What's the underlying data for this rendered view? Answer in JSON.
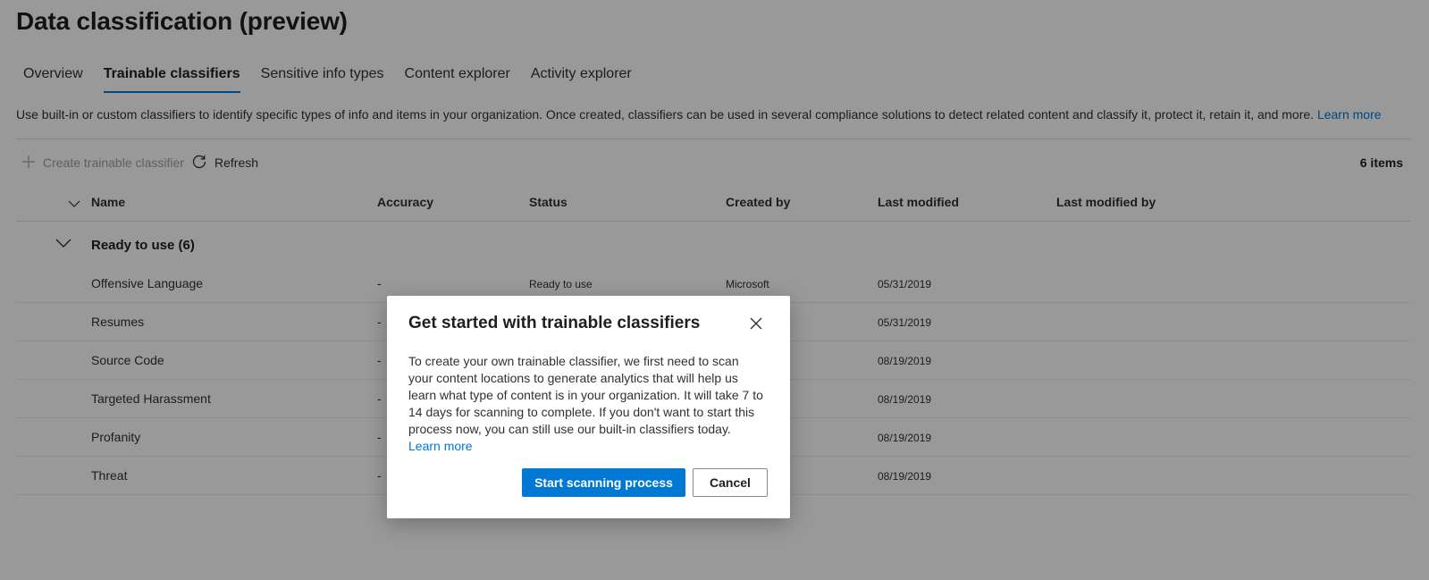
{
  "page": {
    "title": "Data classification (preview)"
  },
  "tabs": [
    {
      "label": "Overview"
    },
    {
      "label": "Trainable classifiers"
    },
    {
      "label": "Sensitive info types"
    },
    {
      "label": "Content explorer"
    },
    {
      "label": "Activity explorer"
    }
  ],
  "active_tab": "Trainable classifiers",
  "description": {
    "text": "Use built-in or custom classifiers to identify specific types of info and items in your organization. Once created, classifiers can be used in several compliance solutions to detect related content and classify it, protect it, retain it, and more.",
    "link": "Learn more"
  },
  "toolbar": {
    "create_label": "Create trainable classifier",
    "refresh_label": "Refresh",
    "items_count": "6 items"
  },
  "columns": {
    "name": "Name",
    "accuracy": "Accuracy",
    "status": "Status",
    "created_by": "Created by",
    "last_modified": "Last modified",
    "last_modified_by": "Last modified by"
  },
  "group": {
    "title": "Ready to use (6)"
  },
  "rows": [
    {
      "name": "Offensive Language",
      "accuracy": "-",
      "status": "Ready to use",
      "created_by": "Microsoft",
      "last_modified": "05/31/2019",
      "last_modified_by": ""
    },
    {
      "name": "Resumes",
      "accuracy": "-",
      "status": "",
      "created_by": "",
      "last_modified": "05/31/2019",
      "last_modified_by": ""
    },
    {
      "name": "Source Code",
      "accuracy": "-",
      "status": "",
      "created_by": "",
      "last_modified": "08/19/2019",
      "last_modified_by": ""
    },
    {
      "name": "Targeted Harassment",
      "accuracy": "-",
      "status": "",
      "created_by": "",
      "last_modified": "08/19/2019",
      "last_modified_by": ""
    },
    {
      "name": "Profanity",
      "accuracy": "-",
      "status": "",
      "created_by": "",
      "last_modified": "08/19/2019",
      "last_modified_by": ""
    },
    {
      "name": "Threat",
      "accuracy": "-",
      "status": "",
      "created_by": "",
      "last_modified": "08/19/2019",
      "last_modified_by": ""
    }
  ],
  "dialog": {
    "title": "Get started with trainable classifiers",
    "body": "To create your own trainable classifier, we first need to scan your content locations to generate analytics that will help us learn what type of content is in your organization. It will take 7 to 14 days for scanning to complete. If you don't want to start this process now, you can still use our built-in classifiers today.",
    "link": "Learn more",
    "primary_label": "Start scanning process",
    "secondary_label": "Cancel"
  },
  "colors": {
    "accent": "#0078d4",
    "overlay": "rgba(0,0,0,0.4)",
    "text": "#323130",
    "disabled": "#a19f9d"
  },
  "icons": {
    "add": "add-icon",
    "refresh": "refresh-icon",
    "chevron": "chevron-down-icon",
    "close": "close-icon"
  }
}
